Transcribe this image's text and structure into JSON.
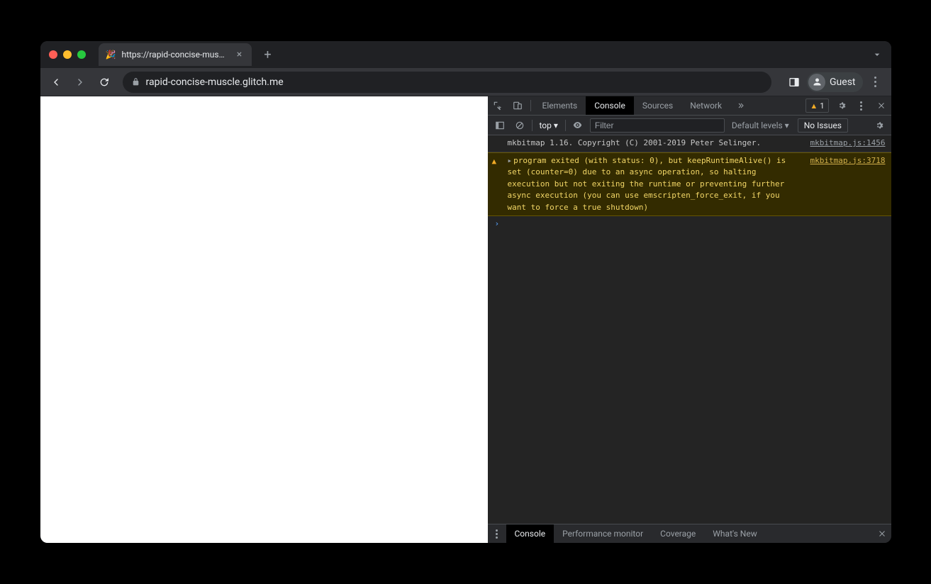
{
  "tab": {
    "title": "https://rapid-concise-muscle.g",
    "favicon": "🎉"
  },
  "omnibox": {
    "url": "rapid-concise-muscle.glitch.me"
  },
  "profile": {
    "label": "Guest"
  },
  "devtools": {
    "tabs": {
      "elements": "Elements",
      "console": "Console",
      "sources": "Sources",
      "network": "Network"
    },
    "warning_count": "1",
    "console_toolbar": {
      "context": "top ▾",
      "filter_placeholder": "Filter",
      "levels": "Default levels ▾",
      "issues": "No Issues"
    },
    "messages": [
      {
        "type": "log",
        "text": "mkbitmap 1.16. Copyright (C) 2001-2019 Peter Selinger.",
        "source": "mkbitmap.js:1456"
      },
      {
        "type": "warning",
        "text": "program exited (with status: 0), but keepRuntimeAlive() is set (counter=0) due to an async operation, so halting execution but not exiting the runtime or preventing further async execution (you can use emscripten_force_exit, if you want to force a true shutdown)",
        "source": "mkbitmap.js:3718"
      }
    ],
    "drawer": {
      "console": "Console",
      "perf": "Performance monitor",
      "coverage": "Coverage",
      "whatsnew": "What's New"
    }
  }
}
